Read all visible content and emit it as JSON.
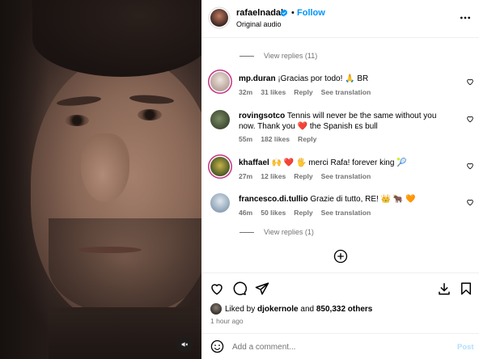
{
  "post": {
    "author": "rafaelnadal",
    "separator": "•",
    "follow_label": "Follow",
    "audio": "Original audio"
  },
  "thread": {
    "view_replies_top": "View replies (11)",
    "view_replies_bottom": "View replies (1)"
  },
  "comments": [
    {
      "user": "mp.duran",
      "text": "¡Gracias por todo! 🙏 BR",
      "time": "32m",
      "likes": "31 likes",
      "reply": "Reply",
      "translation": "See translation",
      "avatar_color": "#d8c7c0"
    },
    {
      "user": "rovingsotco",
      "text": "Tennis will never be the same without you now. Thank you ❤️ the Spanish ᴇs bull",
      "time": "55m",
      "likes": "182 likes",
      "reply": "Reply",
      "translation": "",
      "avatar_color": "#5b6a4a"
    },
    {
      "user": "khaffael",
      "text": "🙌 ❤️ 🖐 merci Rafa! forever king 🎾",
      "time": "27m",
      "likes": "12 likes",
      "reply": "Reply",
      "translation": "See translation",
      "avatar_color": "#6a7b3c"
    },
    {
      "user": "francesco.di.tullio",
      "text": "Grazie di tutto, RE! 👑 🐂 🧡",
      "time": "46m",
      "likes": "50 likes",
      "reply": "Reply",
      "translation": "See translation",
      "avatar_color": "#9fb3c6"
    }
  ],
  "actions": {
    "liked_by_prefix": "Liked by ",
    "liked_by_user": "djokernole",
    "liked_by_and": " and ",
    "liked_by_count": "850,332 others",
    "time_ago": "1 hour ago"
  },
  "composer": {
    "placeholder": "Add a comment...",
    "post_label": "Post"
  },
  "colors": {
    "accent": "#0095f6",
    "muted_text": "#737373",
    "heart_red": "#ed4956",
    "post_disabled": "#b2dffc"
  },
  "icons": [
    "verified-badge-icon",
    "more-options-icon",
    "heart-icon",
    "add-circle-icon",
    "comment-icon",
    "share-icon",
    "save-icon",
    "emoji-icon",
    "mute-icon"
  ]
}
